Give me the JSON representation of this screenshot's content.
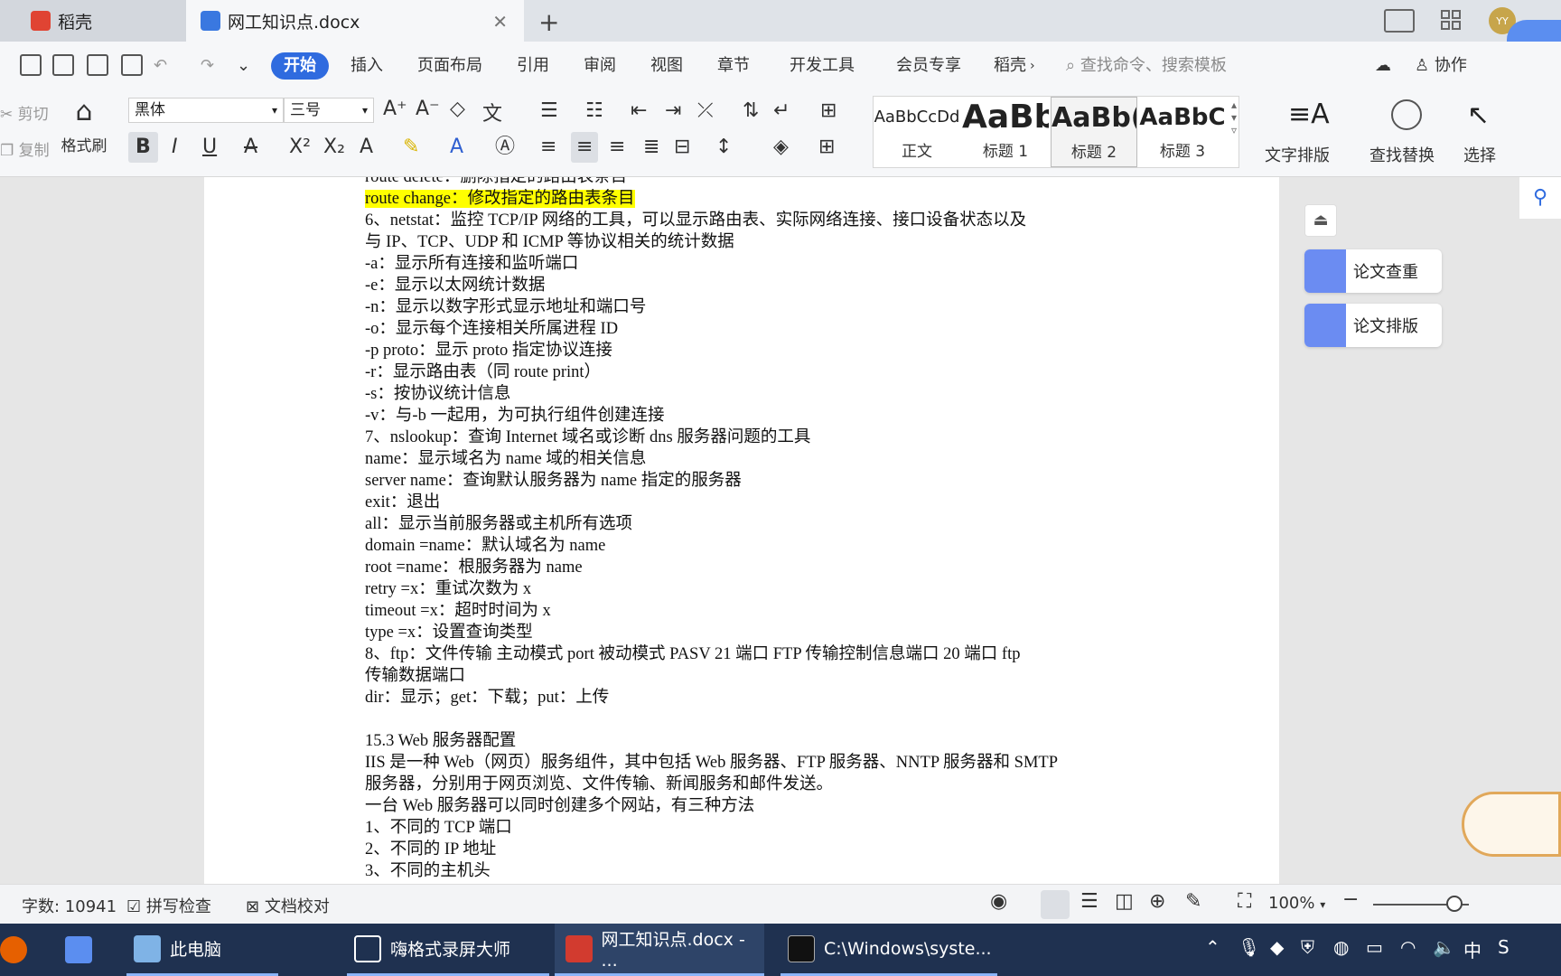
{
  "tabs": [
    {
      "label": "稻壳"
    },
    {
      "label": "网工知识点.docx"
    }
  ],
  "menu": {
    "items": [
      "开始",
      "插入",
      "页面布局",
      "引用",
      "审阅",
      "视图",
      "章节",
      "开发工具",
      "会员专享",
      "稻壳"
    ],
    "search_placeholder": "查找命令、搜索模板",
    "collab": "协作"
  },
  "toolbar": {
    "cut": "剪切",
    "copy": "复制",
    "format_painter": "格式刷",
    "font_name": "黑体",
    "font_size": "三号",
    "styles": [
      {
        "preview": "AaBbCcDd",
        "name": "正文"
      },
      {
        "preview": "AaBb",
        "name": "标题 1"
      },
      {
        "preview": "AaBb(",
        "name": "标题 2"
      },
      {
        "preview": "AaBbC",
        "name": "标题 3"
      }
    ],
    "text_layout": "文字排版",
    "find_replace": "查找替换",
    "select": "选择"
  },
  "document": {
    "lines": [
      {
        "text": "route delete：删除指定的路由表条目",
        "highlight": false
      },
      {
        "text": "route change：修改指定的路由表条目",
        "highlight": true
      },
      {
        "text": "6、netstat：监控 TCP/IP 网络的工具，可以显示路由表、实际网络连接、接口设备状态以及",
        "highlight": false
      },
      {
        "text": "与 IP、TCP、UDP 和 ICMP 等协议相关的统计数据",
        "highlight": false
      },
      {
        "text": "-a：显示所有连接和监听端口",
        "highlight": false
      },
      {
        "text": "-e：显示以太网统计数据",
        "highlight": false
      },
      {
        "text": "-n：显示以数字形式显示地址和端口号",
        "highlight": false
      },
      {
        "text": "-o：显示每个连接相关所属进程 ID",
        "highlight": false
      },
      {
        "text": "-p proto：显示 proto 指定协议连接",
        "highlight": false
      },
      {
        "text": "-r：显示路由表（同 route print）",
        "highlight": false
      },
      {
        "text": "-s：按协议统计信息",
        "highlight": false
      },
      {
        "text": "-v：与-b 一起用，为可执行组件创建连接",
        "highlight": false
      },
      {
        "text": "7、nslookup：查询 Internet 域名或诊断 dns 服务器问题的工具",
        "highlight": false
      },
      {
        "text": "name：显示域名为 name 域的相关信息",
        "highlight": false
      },
      {
        "text": "server name：查询默认服务器为 name 指定的服务器",
        "highlight": false
      },
      {
        "text": "exit：退出",
        "highlight": false
      },
      {
        "text": "all：显示当前服务器或主机所有选项",
        "highlight": false
      },
      {
        "text": "domain =name：默认域名为 name",
        "highlight": false
      },
      {
        "text": "root =name：根服务器为 name",
        "highlight": false
      },
      {
        "text": "retry =x：重试次数为 x",
        "highlight": false
      },
      {
        "text": "timeout =x：超时时间为 x",
        "highlight": false
      },
      {
        "text": "type =x：设置查询类型",
        "highlight": false
      },
      {
        "text": "8、ftp：文件传输 主动模式 port 被动模式 PASV 21 端口 FTP 传输控制信息端口 20 端口 ftp",
        "highlight": false
      },
      {
        "text": "传输数据端口",
        "highlight": false
      },
      {
        "text": "dir：显示；get：下载；put：上传",
        "highlight": false
      },
      {
        "text": "",
        "highlight": false
      },
      {
        "text": "15.3 Web 服务器配置",
        "highlight": false
      },
      {
        "text": "IIS 是一种 Web（网页）服务组件，其中包括 Web 服务器、FTP 服务器、NNTP 服务器和 SMTP",
        "highlight": false
      },
      {
        "text": "服务器，分别用于网页浏览、文件传输、新闻服务和邮件发送。",
        "highlight": false
      },
      {
        "text": "一台 Web 服务器可以同时创建多个网站，有三种方法",
        "highlight": false
      },
      {
        "text": "1、不同的 TCP 端口",
        "highlight": false
      },
      {
        "text": "2、不同的 IP 地址",
        "highlight": false
      },
      {
        "text": "3、不同的主机头",
        "highlight": false
      }
    ]
  },
  "side_panel": {
    "paper_check": "论文查重",
    "paper_layout": "论文排版"
  },
  "status": {
    "word_count": "字数: 10941",
    "spell_check": "拼写检查",
    "doc_proof": "文档校对",
    "zoom": "100%",
    "zoom_level": 0.85
  },
  "taskbar": {
    "items": [
      "此电脑",
      "嗨格式录屏大师",
      "网工知识点.docx - ...",
      "C:\\Windows\\syste..."
    ],
    "ime": "中"
  },
  "colors": {
    "accent": "#2f6bdf",
    "highlight": "#ffff00",
    "taskbar": "#1f3150"
  }
}
